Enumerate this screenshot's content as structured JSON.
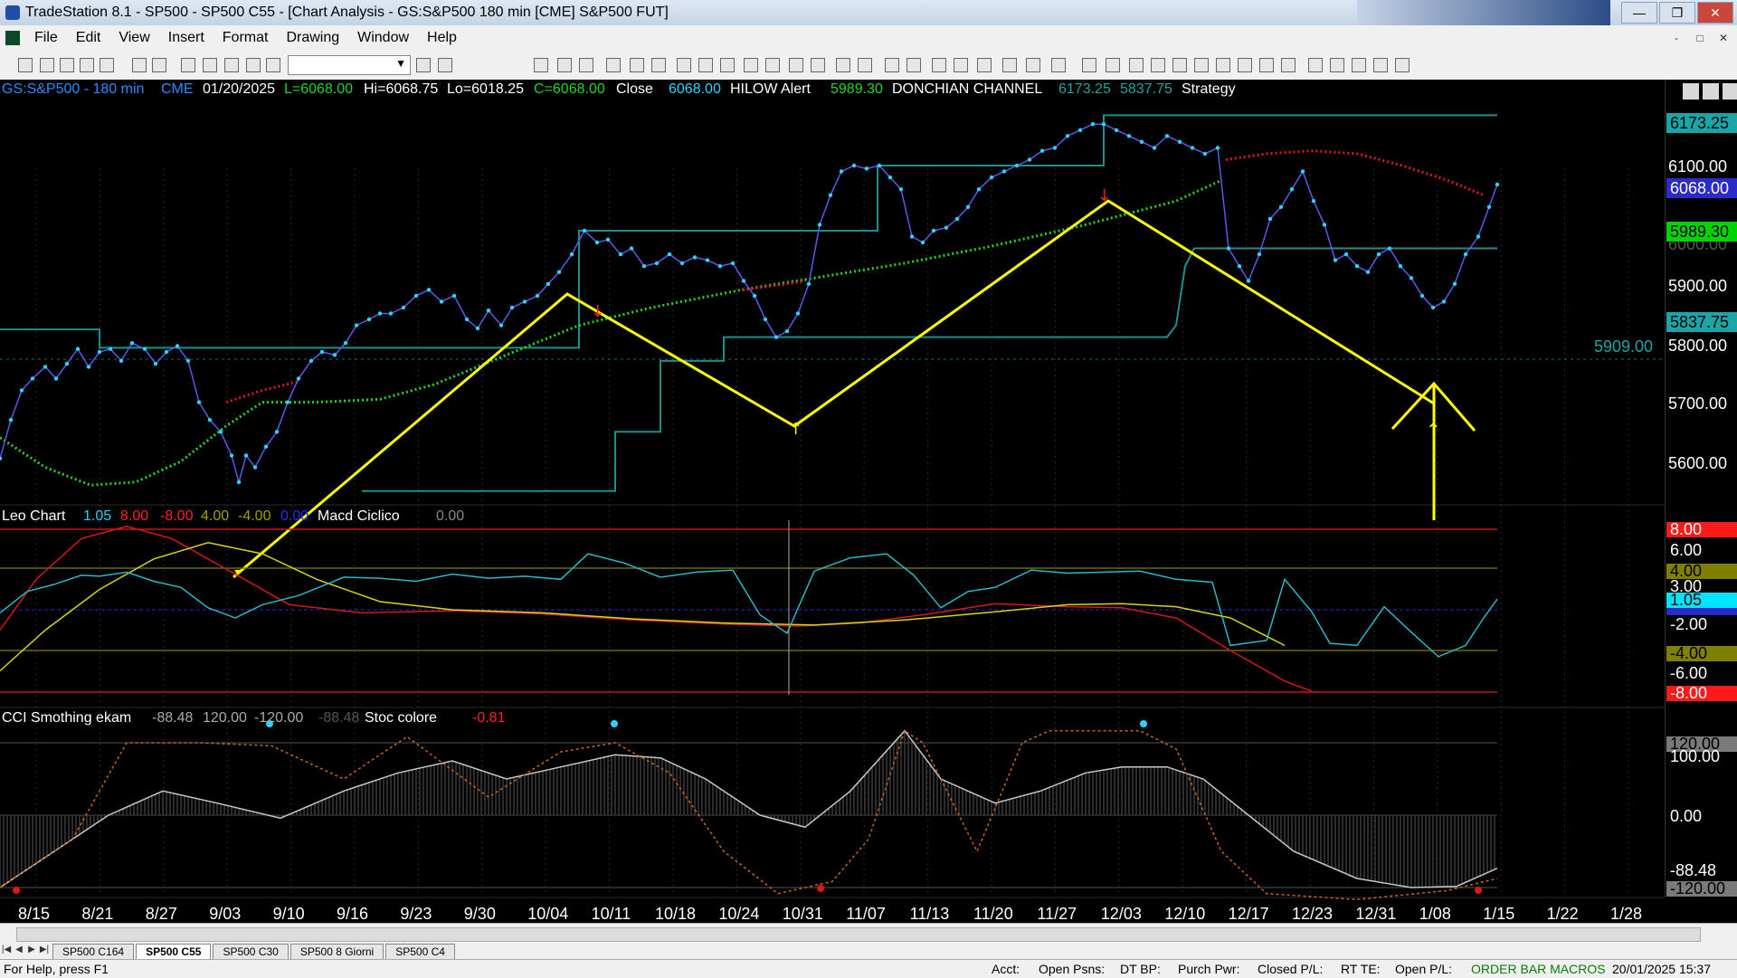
{
  "window": {
    "title": "TradeStation 8.1 - SP500 - SP500 C55 - [Chart Analysis - GS:S&P500  180 min  [CME] S&P500 FUT]",
    "min": "—",
    "max": "❒",
    "close": "✕"
  },
  "menu": [
    "File",
    "Edit",
    "View",
    "Insert",
    "Format",
    "Drawing",
    "Window",
    "Help"
  ],
  "inner_controls": [
    "-",
    "□",
    "✕"
  ],
  "header": {
    "symbol": "GS:S&P500 - 180 min",
    "exchange": "CME",
    "date": "01/20/2025",
    "low_open": "L=6068.00",
    "hi": "Hi=6068.75",
    "lo": "Lo=6018.25",
    "close_val": "C=6068.00",
    "close_label": "Close",
    "close_num": "6068.00",
    "hilow": "HILOW Alert",
    "hilow_val": "5989.30",
    "donchian": "DONCHIAN CHANNEL",
    "don_up": "6173.25",
    "don_dn": "5837.75",
    "strategy": "Strategy"
  },
  "pane2": {
    "name": "Leo Chart",
    "v1": "1.05",
    "v2": "8.00",
    "v3": "-8.00",
    "v4": "4.00",
    "v5": "-4.00",
    "v6": "0.00",
    "name2": "Macd Ciclico",
    "v7": "0.00"
  },
  "pane3": {
    "name": "CCI Smothing ekam",
    "v1": "-88.48",
    "v2": "120.00",
    "v3": "-120.00",
    "v4": "-88.48",
    "name2": "Stoc colore",
    "v5": "-0.81"
  },
  "price_axis": {
    "ticks": [
      "6100.00",
      "6000.00",
      "5900.00",
      "5800.00",
      "5700.00",
      "5600.00"
    ],
    "tags": [
      {
        "text": "6173.25",
        "bg": "#1aa6a6",
        "fg": "#000"
      },
      {
        "text": "6068.00",
        "bg": "#2a2acd",
        "fg": "#fff"
      },
      {
        "text": "5989.30",
        "bg": "#00d400",
        "fg": "#000"
      },
      {
        "text": "5837.75",
        "bg": "#1aa6a6",
        "fg": "#000"
      }
    ],
    "level_label": "5909.00"
  },
  "osc_axis": {
    "ticks": [
      "6.00",
      "3.00",
      "-2.00",
      "-6.00"
    ],
    "tags": [
      {
        "text": "8.00",
        "bg": "#ff1a1a",
        "fg": "#fff"
      },
      {
        "text": "4.00",
        "bg": "#808000",
        "fg": "#000"
      },
      {
        "text": "1.05",
        "bg": "#00e5ff",
        "fg": "#000"
      },
      {
        "text": "-4.00",
        "bg": "#808000",
        "fg": "#000"
      },
      {
        "text": "-8.00",
        "bg": "#ff1a1a",
        "fg": "#fff"
      }
    ]
  },
  "cci_axis": {
    "ticks": [
      "100.00",
      "0.00",
      "-88.48"
    ],
    "tags": [
      {
        "text": "120.00",
        "bg": "#7a7a7a",
        "fg": "#000"
      },
      {
        "text": "-120.00",
        "bg": "#7a7a7a",
        "fg": "#000"
      }
    ]
  },
  "dates": [
    "8/15",
    "8/21",
    "8/27",
    "9/03",
    "9/10",
    "9/16",
    "9/23",
    "9/30",
    "10/04",
    "10/11",
    "10/18",
    "10/24",
    "10/31",
    "11/07",
    "11/13",
    "11/20",
    "11/27",
    "12/03",
    "12/10",
    "12/17",
    "12/23",
    "12/31",
    "1/08",
    "1/15",
    "1/22",
    "1/28"
  ],
  "tabs": [
    "SP500 C164",
    "SP500 C55",
    "SP500 C30",
    "SP500 8 Giorni",
    "SP500 C4"
  ],
  "active_tab": 1,
  "status": {
    "help": "For Help, press F1",
    "acct": "Acct:",
    "open_psns": "Open Psns:",
    "dt_bp": "DT BP:",
    "purch": "Purch Pwr:",
    "closed": "Closed P/L:",
    "rt_te": "RT TE:",
    "open_pl": "Open P/L:",
    "macros": "ORDER BAR  MACROS",
    "datetime": "20/01/2025 15:37"
  }
}
